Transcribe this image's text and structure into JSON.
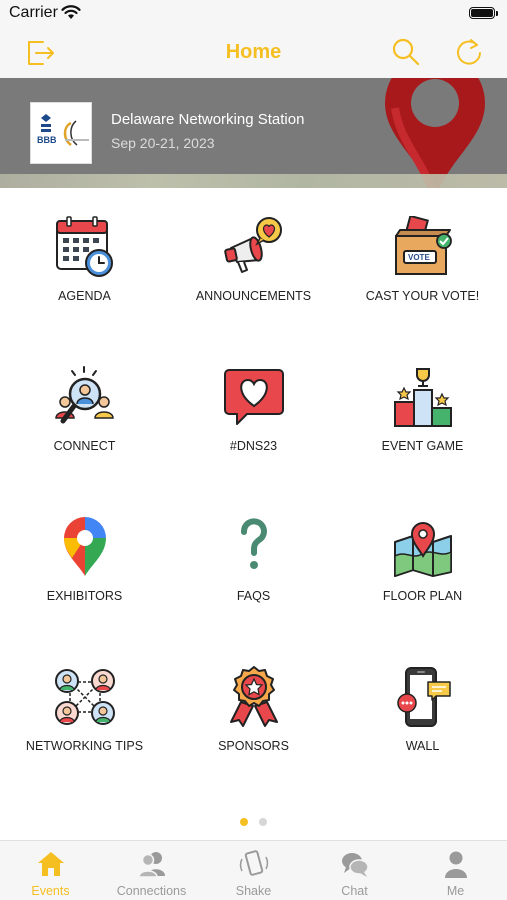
{
  "status_bar": {
    "carrier": "Carrier"
  },
  "nav": {
    "title": "Home",
    "left_icon": "logout-icon",
    "right_icons": [
      "search-icon",
      "refresh-icon"
    ],
    "accent": "#f5bf22"
  },
  "banner": {
    "logo_text": "BBB",
    "event_name": "Delaware Networking Station",
    "event_dates": "Sep 20-21, 2023"
  },
  "tiles": [
    {
      "label": "AGENDA",
      "icon": "calendar-clock-icon"
    },
    {
      "label": "ANNOUNCEMENTS",
      "icon": "megaphone-icon"
    },
    {
      "label": "CAST YOUR VOTE!",
      "icon": "ballot-box-icon"
    },
    {
      "label": "CONNECT",
      "icon": "people-search-icon"
    },
    {
      "label": "#DNS23",
      "icon": "heart-chat-icon"
    },
    {
      "label": "EVENT GAME",
      "icon": "podium-trophy-icon"
    },
    {
      "label": "EXHIBITORS",
      "icon": "map-pin-icon"
    },
    {
      "label": "FAQS",
      "icon": "question-mark-icon"
    },
    {
      "label": "FLOOR PLAN",
      "icon": "folded-map-icon"
    },
    {
      "label": "NETWORKING TIPS",
      "icon": "network-people-icon"
    },
    {
      "label": "SPONSORS",
      "icon": "award-badge-icon"
    },
    {
      "label": "WALL",
      "icon": "phone-chat-icon"
    }
  ],
  "pager": {
    "pages": 2,
    "current": 1
  },
  "tabs": [
    {
      "label": "Events",
      "icon": "home-icon",
      "active": true
    },
    {
      "label": "Connections",
      "icon": "users-icon",
      "active": false
    },
    {
      "label": "Shake",
      "icon": "shake-phone-icon",
      "active": false
    },
    {
      "label": "Chat",
      "icon": "chat-bubbles-icon",
      "active": false
    },
    {
      "label": "Me",
      "icon": "user-icon",
      "active": false
    }
  ]
}
